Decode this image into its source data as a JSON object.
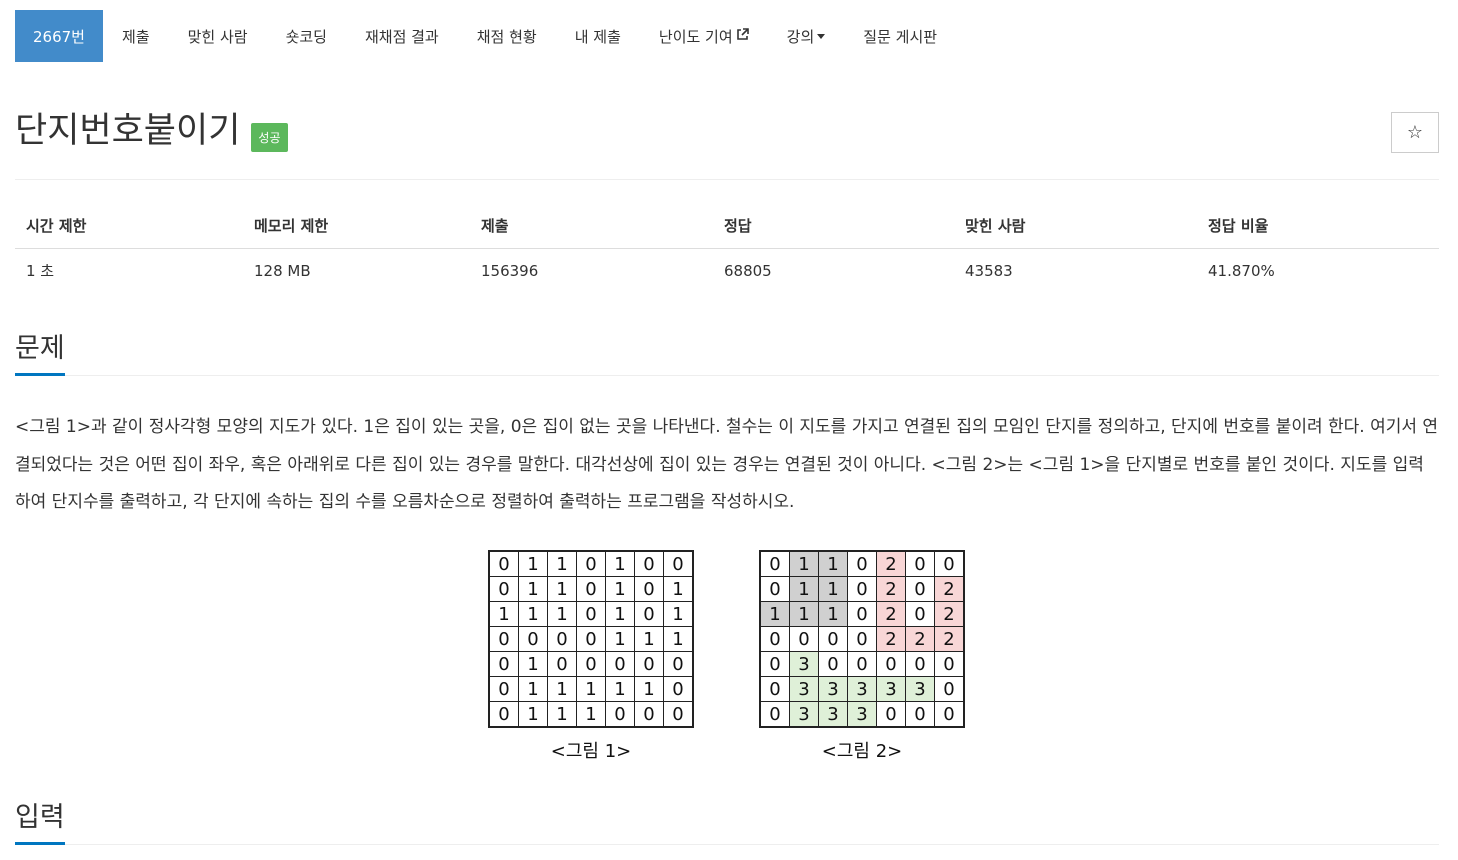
{
  "nav": {
    "items": [
      {
        "label": "2667번",
        "active": true
      },
      {
        "label": "제출"
      },
      {
        "label": "맞힌 사람"
      },
      {
        "label": "숏코딩"
      },
      {
        "label": "재채점 결과"
      },
      {
        "label": "채점 현황"
      },
      {
        "label": "내 제출"
      },
      {
        "label": "난이도 기여",
        "icon": "external-link-icon"
      },
      {
        "label": "강의",
        "icon": "caret-down-icon"
      },
      {
        "label": "질문 게시판"
      }
    ]
  },
  "problem": {
    "title": "단지번호붙이기",
    "badge": "성공",
    "star": "☆"
  },
  "stats": {
    "headers": [
      "시간 제한",
      "메모리 제한",
      "제출",
      "정답",
      "맞힌 사람",
      "정답 비율"
    ],
    "values": [
      "1 초",
      "128 MB",
      "156396",
      "68805",
      "43583",
      "41.870%"
    ]
  },
  "sections": {
    "problem_heading": "문제",
    "input_heading": "입력"
  },
  "description": "<그림 1>과 같이 정사각형 모양의 지도가 있다. 1은 집이 있는 곳을, 0은 집이 없는 곳을 나타낸다. 철수는 이 지도를 가지고 연결된 집의 모임인 단지를 정의하고, 단지에 번호를 붙이려 한다. 여기서 연결되었다는 것은 어떤 집이 좌우, 혹은 아래위로 다른 집이 있는 경우를 말한다. 대각선상에 집이 있는 경우는 연결된 것이 아니다. <그림 2>는 <그림 1>을 단지별로 번호를 붙인 것이다. 지도를 입력하여 단지수를 출력하고, 각 단지에 속하는 집의 수를 오름차순으로 정렬하여 출력하는 프로그램을 작성하시오.",
  "figures": {
    "fig1": {
      "caption": "<그림 1>",
      "grid": [
        [
          "0",
          "1",
          "1",
          "0",
          "1",
          "0",
          "0"
        ],
        [
          "0",
          "1",
          "1",
          "0",
          "1",
          "0",
          "1"
        ],
        [
          "1",
          "1",
          "1",
          "0",
          "1",
          "0",
          "1"
        ],
        [
          "0",
          "0",
          "0",
          "0",
          "1",
          "1",
          "1"
        ],
        [
          "0",
          "1",
          "0",
          "0",
          "0",
          "0",
          "0"
        ],
        [
          "0",
          "1",
          "1",
          "1",
          "1",
          "1",
          "0"
        ],
        [
          "0",
          "1",
          "1",
          "1",
          "0",
          "0",
          "0"
        ]
      ]
    },
    "fig2": {
      "caption": "<그림 2>",
      "grid": [
        [
          "0",
          "1",
          "1",
          "0",
          "2",
          "0",
          "0"
        ],
        [
          "0",
          "1",
          "1",
          "0",
          "2",
          "0",
          "2"
        ],
        [
          "1",
          "1",
          "1",
          "0",
          "2",
          "0",
          "2"
        ],
        [
          "0",
          "0",
          "0",
          "0",
          "2",
          "2",
          "2"
        ],
        [
          "0",
          "3",
          "0",
          "0",
          "0",
          "0",
          "0"
        ],
        [
          "0",
          "3",
          "3",
          "3",
          "3",
          "3",
          "0"
        ],
        [
          "0",
          "3",
          "3",
          "3",
          "0",
          "0",
          "0"
        ]
      ],
      "colors": {
        "1": "#d0d0d0",
        "2": "#f8d6d6",
        "3": "#dff0d8"
      }
    }
  }
}
